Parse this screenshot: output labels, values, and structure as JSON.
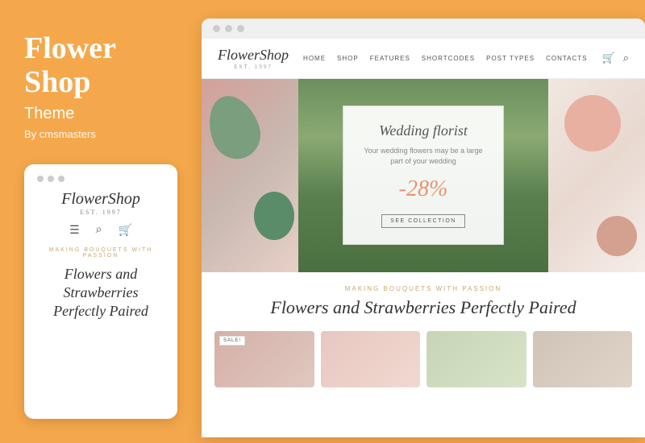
{
  "left": {
    "title_line1": "Flower",
    "title_line2": "Shop",
    "subtitle": "Theme",
    "author": "By cmsmasters"
  },
  "mobile_card": {
    "logo": "FlowerShop",
    "logo_sub": "EST. 1997",
    "tagline": "Making Bouquets With Passion",
    "heading": "Flowers and Strawberries Perfectly Paired"
  },
  "browser": {
    "nav_links": [
      "Home",
      "Shop",
      "Features",
      "Shortcodes",
      "Post Types",
      "Contacts"
    ],
    "logo": "FlowerShop",
    "logo_sub": "EST. 1997"
  },
  "hero": {
    "title": "Wedding florist",
    "description": "Your wedding flowers may be a large part of your wedding",
    "discount": "-28%",
    "button": "SEE COLLECTION"
  },
  "tagline": {
    "small": "Making Bouquets With Passion",
    "heading": "Flowers and Strawberries Perfectly Paired"
  },
  "products": [
    {
      "has_sale": true
    },
    {
      "has_sale": false
    },
    {
      "has_sale": false
    },
    {
      "has_sale": false
    }
  ],
  "sale_label": "SALE!"
}
